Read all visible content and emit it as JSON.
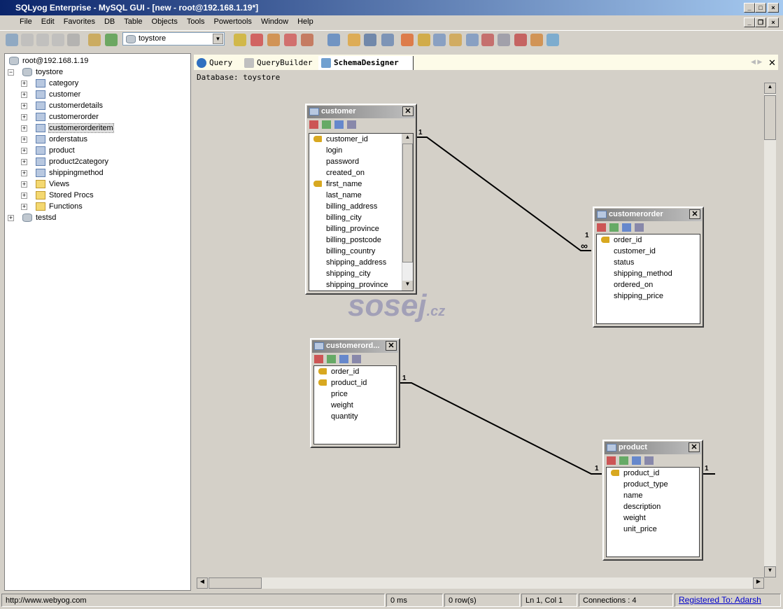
{
  "window": {
    "title": "SQLyog Enterprise - MySQL GUI - [new - root@192.168.1.19*]"
  },
  "menu": [
    "File",
    "Edit",
    "Favorites",
    "DB",
    "Table",
    "Objects",
    "Tools",
    "Powertools",
    "Window",
    "Help"
  ],
  "toolbar": {
    "database_select": "toystore"
  },
  "tree": {
    "root": "root@192.168.1.19",
    "databases": [
      {
        "name": "toystore",
        "children": [
          "category",
          "customer",
          "customerdetails",
          "customerorder",
          "customerorderitem",
          "orderstatus",
          "product",
          "product2category",
          "shippingmethod"
        ],
        "folders": [
          "Views",
          "Stored Procs",
          "Functions"
        ]
      },
      {
        "name": "testsd"
      }
    ],
    "selected": "customerorderitem"
  },
  "tabs": [
    {
      "label": "Query"
    },
    {
      "label": "QueryBuilder"
    },
    {
      "label": "SchemaDesigner",
      "active": true
    }
  ],
  "designer": {
    "database_label": "Database: toystore",
    "tables": [
      {
        "name": "customer",
        "columns": [
          {
            "n": "customer_id",
            "k": true
          },
          {
            "n": "login"
          },
          {
            "n": "password"
          },
          {
            "n": "created_on"
          },
          {
            "n": "first_name",
            "k": true
          },
          {
            "n": "last_name"
          },
          {
            "n": "billing_address"
          },
          {
            "n": "billing_city"
          },
          {
            "n": "billing_province"
          },
          {
            "n": "billing_postcode"
          },
          {
            "n": "billing_country"
          },
          {
            "n": "shipping_address"
          },
          {
            "n": "shipping_city"
          },
          {
            "n": "shipping_province"
          }
        ]
      },
      {
        "name": "customerorder",
        "columns": [
          {
            "n": "order_id",
            "k": true
          },
          {
            "n": "customer_id"
          },
          {
            "n": "status"
          },
          {
            "n": "shipping_method"
          },
          {
            "n": "ordered_on"
          },
          {
            "n": "shipping_price"
          }
        ]
      },
      {
        "name": "customerord...",
        "columns": [
          {
            "n": "order_id",
            "k": true
          },
          {
            "n": "product_id",
            "k": true
          },
          {
            "n": "price"
          },
          {
            "n": "weight"
          },
          {
            "n": "quantity"
          }
        ]
      },
      {
        "name": "product",
        "columns": [
          {
            "n": "product_id",
            "k": true
          },
          {
            "n": "product_type"
          },
          {
            "n": "name"
          },
          {
            "n": "description"
          },
          {
            "n": "weight"
          },
          {
            "n": "unit_price"
          }
        ]
      }
    ],
    "relation_labels": {
      "one": "1",
      "many": "∞"
    },
    "watermark": "sosej.cz"
  },
  "status": {
    "url": "http://www.webyog.com",
    "time": "0 ms",
    "rows": "0 row(s)",
    "position": "Ln 1, Col 1",
    "connections": "Connections : 4",
    "registered": "Registered To: Adarsh"
  }
}
